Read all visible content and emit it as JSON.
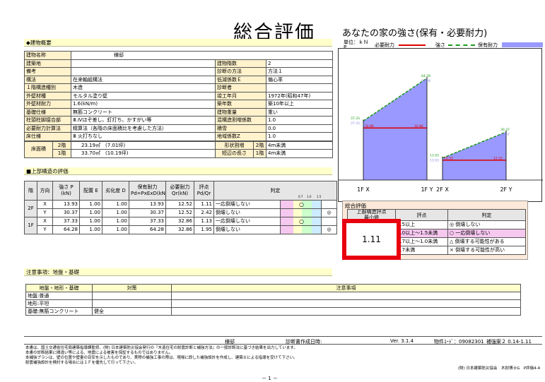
{
  "title": "総合評価",
  "strength_title": "あなたの家の強さ(保有・必要耐力)",
  "building": {
    "section_label": "◆建物概要",
    "rows": [
      [
        "建物名称",
        "様邸",
        "",
        ""
      ],
      [
        "建築地",
        "",
        "建物階数",
        "2"
      ],
      [
        "備考",
        "",
        "診断の方法",
        "方法１"
      ],
      [
        "構法",
        "在来軸組構法",
        "低減係数Ｅ",
        "偏心率"
      ],
      [
        "１階構造種別",
        "木造",
        "診断者",
        ""
      ],
      [
        "外壁材種",
        "モルタル塗り壁",
        "竣工年月",
        "1972年(昭和47年)"
      ],
      [
        "外壁材耐力",
        "1.6(kN/m)",
        "築年数",
        "築10年以上"
      ],
      [
        "基礎仕様",
        "無筋コンクリート",
        "建物重量",
        "重い"
      ],
      [
        "柱頭柱脚接合部",
        "Ⅲ.Ⅳほぞ差し、釘打ち、かすがい等",
        "混構造割増係数",
        "1.0"
      ],
      [
        "必要耐力計算法",
        "精算法（各階の床面積比を考慮した方法）",
        "積雪",
        "0.0"
      ],
      [
        "床仕様",
        "Ⅲ 火打ちなし",
        "地域係数Z",
        "1.0"
      ]
    ],
    "floor_area_label": "床面積",
    "floor_2_label": "2階",
    "floor_2_value": "23.19㎡　(7.01坪)",
    "floor_1_label": "1階",
    "floor_1_value": "33.70㎡　(10.19坪)",
    "shape_label": "形状割増",
    "short_side_label": "短辺の長さ",
    "shape_floor_2": "2階",
    "shape_floor_2_value": "4m未満",
    "shape_floor_1": "1階",
    "shape_floor_1_value": "4m未満"
  },
  "upper": {
    "section_label": "■上部構造の評価",
    "headers": [
      "階",
      "方向",
      "強さ P\n(kN)",
      "配置 E",
      "劣化度 D",
      "保有耐力\nPd=PxExD(kN)",
      "必要耐力\nQr(kN)",
      "評点\nPd/Qr",
      "判定"
    ],
    "gauge_ticks": [
      "0.7",
      "1.0",
      "1.5"
    ],
    "floors": [
      {
        "floor": "2F",
        "rows": [
          {
            "dir": "X",
            "P": "13.93",
            "E": "1.00",
            "D": "1.00",
            "Pd": "13.93",
            "Qr": "12.52",
            "score": "1.11",
            "judge": "一応倒壊しない",
            "mark": "○"
          },
          {
            "dir": "Y",
            "P": "30.37",
            "E": "1.00",
            "D": "1.00",
            "Pd": "30.37",
            "Qr": "12.52",
            "score": "2.42",
            "judge": "倒壊しない",
            "mark": "◎"
          }
        ]
      },
      {
        "floor": "1F",
        "rows": [
          {
            "dir": "X",
            "P": "37.33",
            "E": "1.00",
            "D": "1.00",
            "Pd": "37.33",
            "Qr": "32.86",
            "score": "1.13",
            "judge": "一応倒壊しない",
            "mark": "○"
          },
          {
            "dir": "Y",
            "P": "64.28",
            "E": "1.00",
            "D": "1.00",
            "Pd": "64.28",
            "Qr": "32.86",
            "score": "1.95",
            "judge": "倒壊しない",
            "mark": "◎"
          }
        ]
      }
    ]
  },
  "sogo": {
    "label": "総合評価",
    "score_head": "上部構造評点\n最小値",
    "score": "1.11",
    "col_score": "評点",
    "col_judge": "判定",
    "rows": [
      [
        "1.5以上",
        "◎ 倒壊しない"
      ],
      [
        "1.0以上～1.5未満",
        "○ 一応倒壊しない"
      ],
      [
        "0.7以上～1.0未満",
        "△ 倒壊する可能性がある"
      ],
      [
        "0.7未満",
        "× 倒壊する可能性が高い"
      ]
    ]
  },
  "notes": {
    "section_label": "注意事項：地盤・基礎",
    "headers": [
      "地盤・地形・基礎",
      "対策",
      "注意事項"
    ],
    "rows": [
      [
        "地盤:普通",
        "",
        ""
      ],
      [
        "地形:平坦",
        "",
        ""
      ],
      [
        "基礎:無筋コンクリート",
        "健全",
        ""
      ]
    ]
  },
  "footer": {
    "name": "様邸",
    "date_label": "診断書作成日時:",
    "version": "Ver. 3.1.4",
    "code": "物件ｺｰﾄﾞ：09082301",
    "revision": "補強案２ 0.14-1.11",
    "disclaimer": [
      "本書は、国土交通省住宅局建築指導課監修、(財) 日本建築防災協会発行の『木造住宅の耐震診断と補強方法』の一般診断法に基づき結果を出力しています。",
      "本書の診断結果に間違い等による、地震による被害を保証するものではありません。",
      "本補強プランは、壁の位置や壁量の目安を示したものであり、実際の補強工事の際は、現場に即した補強設計を作成し、建築士による指導を受けて下さい。",
      "耐震補強設計を検討する場合には１Ｆを優先して行って下さい。"
    ],
    "credit": "(財) 日本建築防災協会　木耐博士G　P評価4-4",
    "page": "－ 1 －"
  },
  "chart_data": {
    "type": "area",
    "unit_label": "単位：ｋＮ",
    "p_label": "P",
    "legend": [
      {
        "name": "必要耐力",
        "color": "#e00000",
        "style": "solid"
      },
      {
        "name": "強さ",
        "color": "#1a9a1a",
        "style": "dashed"
      },
      {
        "name": "保有耐力",
        "color": "#9999ff",
        "style": "area"
      }
    ],
    "groups": [
      {
        "x_labels": [
          "1F X",
          "1F Y"
        ],
        "required": [
          32.86,
          32.86
        ],
        "strength": [
          37.33,
          64.28
        ],
        "held": [
          37.33,
          64.28
        ]
      },
      {
        "x_labels": [
          "2F X",
          "2F Y"
        ],
        "required": [
          12.52,
          12.52
        ],
        "strength": [
          13.93,
          30.37
        ],
        "held": [
          13.93,
          30.37
        ]
      }
    ],
    "ylim": [
      0,
      80
    ]
  }
}
